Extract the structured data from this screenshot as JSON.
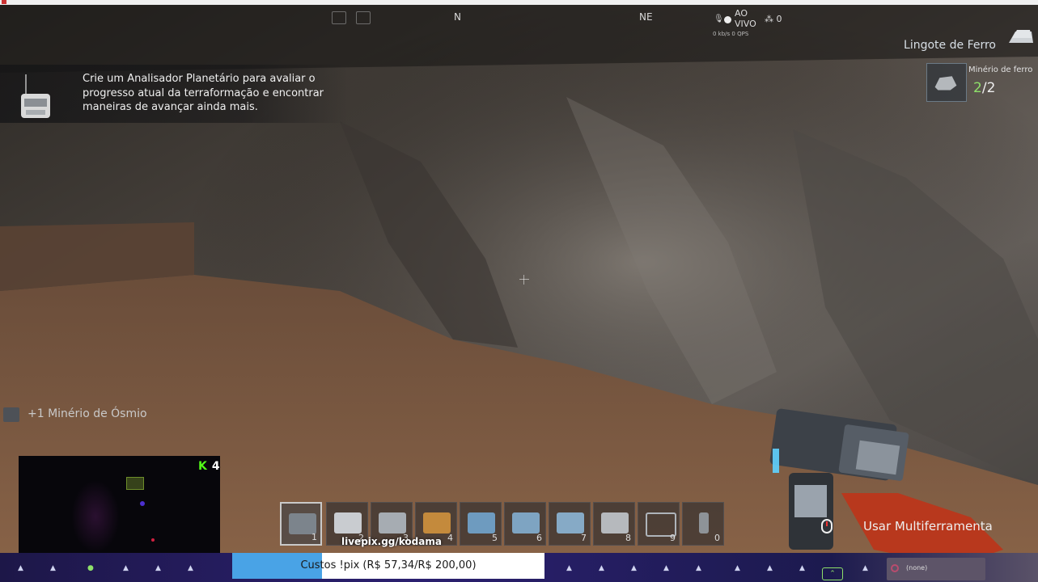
{
  "compass": {
    "marks": [
      "N",
      "NE"
    ],
    "icons": [
      "map-icon",
      "scan-icon"
    ]
  },
  "stream": {
    "live_label_1": "AO",
    "live_label_2": "VIVO",
    "stats": "0 kb/s 0 QPS",
    "viewer_count": "0"
  },
  "objective": {
    "text": "Crie um Analisador Planetário para avaliar o progresso atual da terraformação e encontrar maneiras de avançar ainda mais."
  },
  "craft_target": {
    "title": "Lingote de Ferro",
    "requirement_name": "Minério de ferro",
    "have": "2",
    "separator": "/",
    "need": "2"
  },
  "pickup": {
    "text": "+1 Minério de Ósmio"
  },
  "webcam": {
    "platform_icon": "kick-icon",
    "platform_letter": "K",
    "viewer_count": "4"
  },
  "hotbar": {
    "slots": [
      {
        "num": "1",
        "icon": "multitool-icon",
        "active": true
      },
      {
        "num": "2",
        "icon": "drill-icon"
      },
      {
        "num": "3",
        "icon": "heater-icon"
      },
      {
        "num": "4",
        "icon": "lamp-icon"
      },
      {
        "num": "5",
        "icon": "container-icon"
      },
      {
        "num": "6",
        "icon": "generator-icon"
      },
      {
        "num": "7",
        "icon": "battery-icon"
      },
      {
        "num": "8",
        "icon": "crafter-icon"
      },
      {
        "num": "9",
        "icon": "windturbine-icon"
      },
      {
        "num": "0",
        "icon": "beacon-icon"
      }
    ]
  },
  "livepix": "livepix.gg/kodama",
  "tool_hint": "Usar Multiferramenta",
  "bottom": {
    "custos": "Custos !pix (R$ 57,34/R$ 200,00)",
    "progress": 0.2867,
    "none_label": "(none)"
  },
  "colors": {
    "accent_green": "#8ee06a",
    "progress_blue": "#49a3e6",
    "kick_green": "#53fc18"
  }
}
